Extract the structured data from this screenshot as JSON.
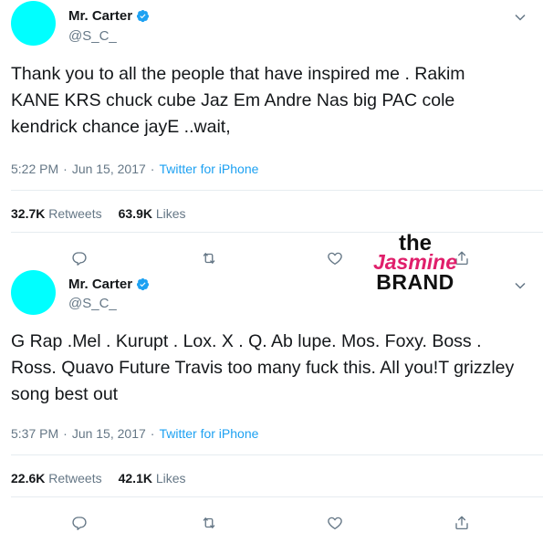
{
  "colors": {
    "avatar": "#00ffff",
    "accent": "#1da1f2",
    "muted": "#657786",
    "watermark_accent": "#e01f6b"
  },
  "tweets": [
    {
      "display_name": "Mr. Carter",
      "handle": "@S_C_",
      "text": "Thank you to all the people that have inspired me . Rakim KANE KRS chuck cube Jaz Em Andre Nas big PAC cole kendrick chance jayE ..wait,",
      "time": "5:22 PM",
      "date": "Jun 15, 2017",
      "source": "Twitter for iPhone",
      "retweets": "32.7K",
      "retweets_label": "Retweets",
      "likes": "63.9K",
      "likes_label": "Likes"
    },
    {
      "display_name": "Mr. Carter",
      "handle": "@S_C_",
      "text": "G Rap .Mel . Kurupt . Lox. X . Q. Ab lupe. Mos. Foxy. Boss . Ross. Quavo Future Travis too many fuck this. All you!T grizzley song best out",
      "time": "5:37 PM",
      "date": "Jun 15, 2017",
      "source": "Twitter for iPhone",
      "retweets": "22.6K",
      "retweets_label": "Retweets",
      "likes": "42.1K",
      "likes_label": "Likes"
    }
  ],
  "separator": "·",
  "icons": [
    "verified-badge-icon",
    "chevron-down-icon",
    "reply-icon",
    "retweet-icon",
    "like-icon",
    "share-icon"
  ],
  "watermark": {
    "line1": "the",
    "line2": "Jasmine",
    "line3": "BRAND"
  }
}
